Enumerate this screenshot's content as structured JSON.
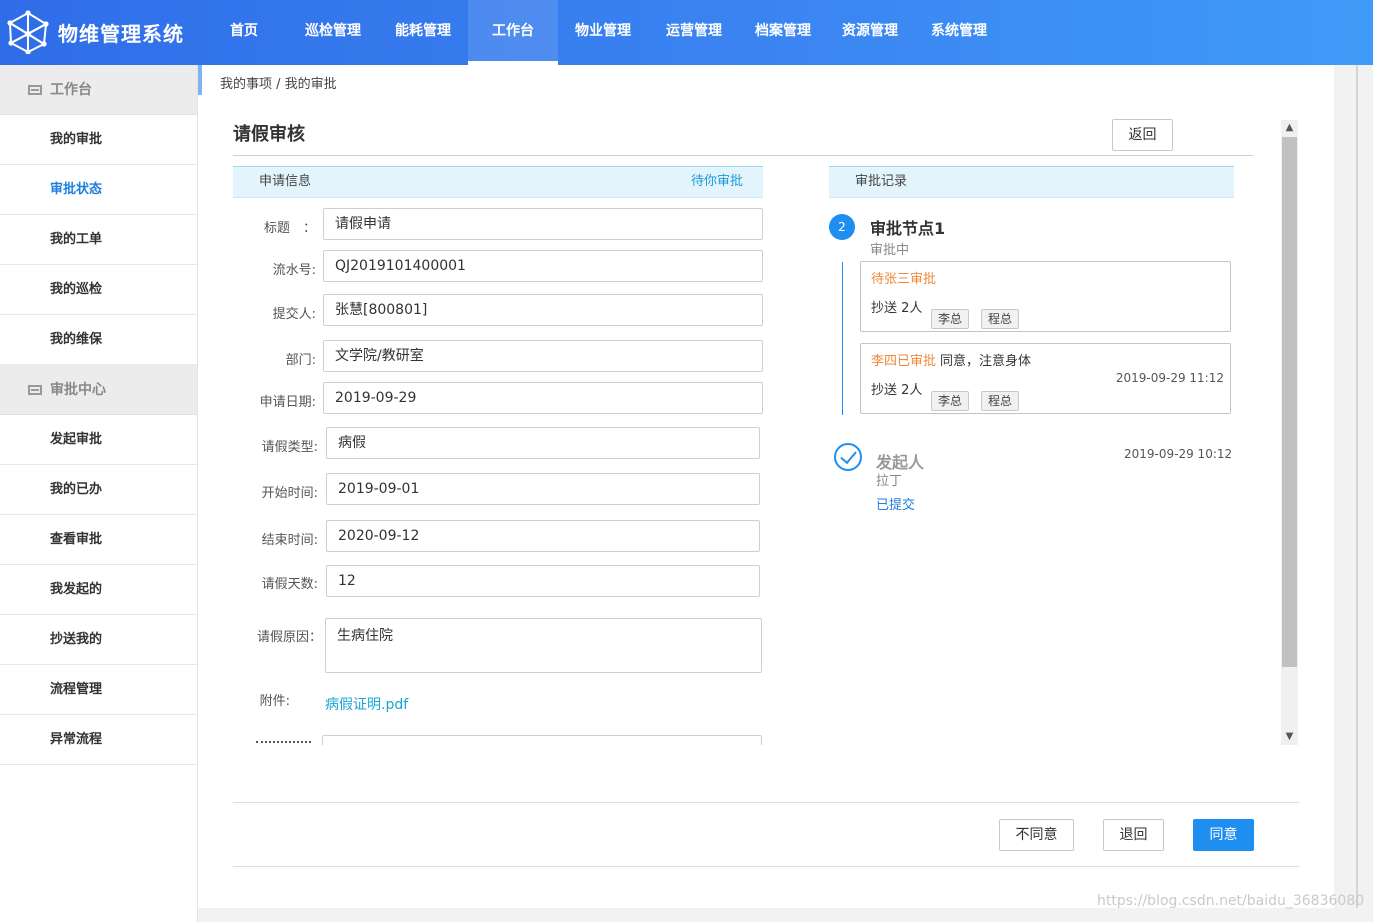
{
  "app": {
    "title": "物维管理系统"
  },
  "top_nav": [
    {
      "label": "首页"
    },
    {
      "label": "巡检管理"
    },
    {
      "label": "能耗管理"
    },
    {
      "label": "工作台",
      "active": true
    },
    {
      "label": "物业管理"
    },
    {
      "label": "运营管理"
    },
    {
      "label": "档案管理"
    },
    {
      "label": "资源管理"
    },
    {
      "label": "系统管理"
    }
  ],
  "sidebar": {
    "groups": [
      {
        "label": "工作台",
        "icon": "list-icon",
        "items": [
          {
            "label": "我的审批"
          },
          {
            "label": "审批状态",
            "active": true
          },
          {
            "label": "我的工单"
          },
          {
            "label": "我的巡检"
          },
          {
            "label": "我的维保"
          }
        ]
      },
      {
        "label": "审批中心",
        "icon": "list-icon",
        "items": [
          {
            "label": "发起审批"
          },
          {
            "label": "我的已办"
          },
          {
            "label": "查看审批"
          },
          {
            "label": "我发起的"
          },
          {
            "label": "抄送我的"
          },
          {
            "label": "流程管理"
          },
          {
            "label": "异常流程"
          }
        ]
      }
    ]
  },
  "breadcrumb": "我的事项 / 我的审批",
  "page": {
    "title": "请假审核",
    "return_button": "返回"
  },
  "apply_info": {
    "header": "申请信息",
    "status": "待你审批",
    "fields": {
      "title": {
        "label": "标题　：",
        "value": "请假申请"
      },
      "serial": {
        "label": "流水号:",
        "value": "QJ2019101400001"
      },
      "submitter": {
        "label": "提交人:",
        "value": "张慧[800801]"
      },
      "department": {
        "label": "部门:",
        "value": "文学院/教研室"
      },
      "apply_date": {
        "label": "申请日期:",
        "value": "2019-09-29"
      },
      "leave_type": {
        "label": "请假类型:",
        "value": "病假"
      },
      "start_time": {
        "label": "开始时间:",
        "value": "2019-09-01"
      },
      "end_time": {
        "label": "结束时间:",
        "value": "2020-09-12"
      },
      "days": {
        "label": "请假天数:",
        "value": "12"
      },
      "reason": {
        "label": "请假原因：",
        "value": "生病住院"
      },
      "attachment": {
        "label": "附件:",
        "value": "病假证明.pdf"
      }
    }
  },
  "approval_record": {
    "header": "审批记录",
    "node": {
      "number": "2",
      "title": "审批节点1",
      "status": "审批中",
      "cards": [
        {
          "who": "待张三审批",
          "note": "",
          "cc": "抄送 2人",
          "tags": [
            "李总",
            "程总"
          ],
          "time": ""
        },
        {
          "who": "李四已审批",
          "note": "同意，注意身体",
          "cc": "抄送 2人",
          "tags": [
            "李总",
            "程总"
          ],
          "time": "2019-09-29 11:12"
        }
      ]
    },
    "initiator": {
      "title": "发起人",
      "name": "拉丁",
      "status": "已提交",
      "time": "2019-09-29 10:12"
    }
  },
  "footer": {
    "disagree": "不同意",
    "return": "退回",
    "agree": "同意"
  },
  "watermark": "https://blog.csdn.net/baidu_36836080",
  "colors": {
    "header_start": "#2f6de8",
    "header_end": "#3f9bf8",
    "primary": "#1f8ef1",
    "pending_orange": "#f0883a",
    "link_cyan": "#19a6d6"
  }
}
